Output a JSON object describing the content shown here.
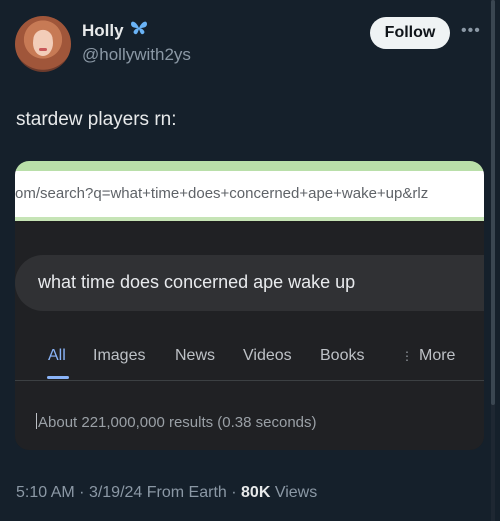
{
  "post": {
    "display_name": "Holly",
    "badge_icon": "butterfly-icon",
    "handle": "@hollywith2ys",
    "follow_label": "Follow",
    "text": "stardew players rn:",
    "time": "5:10 AM",
    "date": "3/19/24",
    "source": "From Earth",
    "views_count": "80K",
    "views_label": "Views",
    "separator": "·"
  },
  "screenshot": {
    "url": "om/search?q=what+time+does+concerned+ape+wake+up&rlz",
    "query": "what time does concerned ape wake up",
    "tabs": [
      {
        "label": "All",
        "active": true
      },
      {
        "label": "Images"
      },
      {
        "label": "News"
      },
      {
        "label": "Videos"
      },
      {
        "label": "Books"
      },
      {
        "label": "More"
      }
    ],
    "results_stats": "About 221,000,000 results (0.38 seconds)"
  },
  "colors": {
    "background": "#15202b",
    "accent_link": "#8ab4f8",
    "urlbar_tint": "#b9dfa9"
  }
}
